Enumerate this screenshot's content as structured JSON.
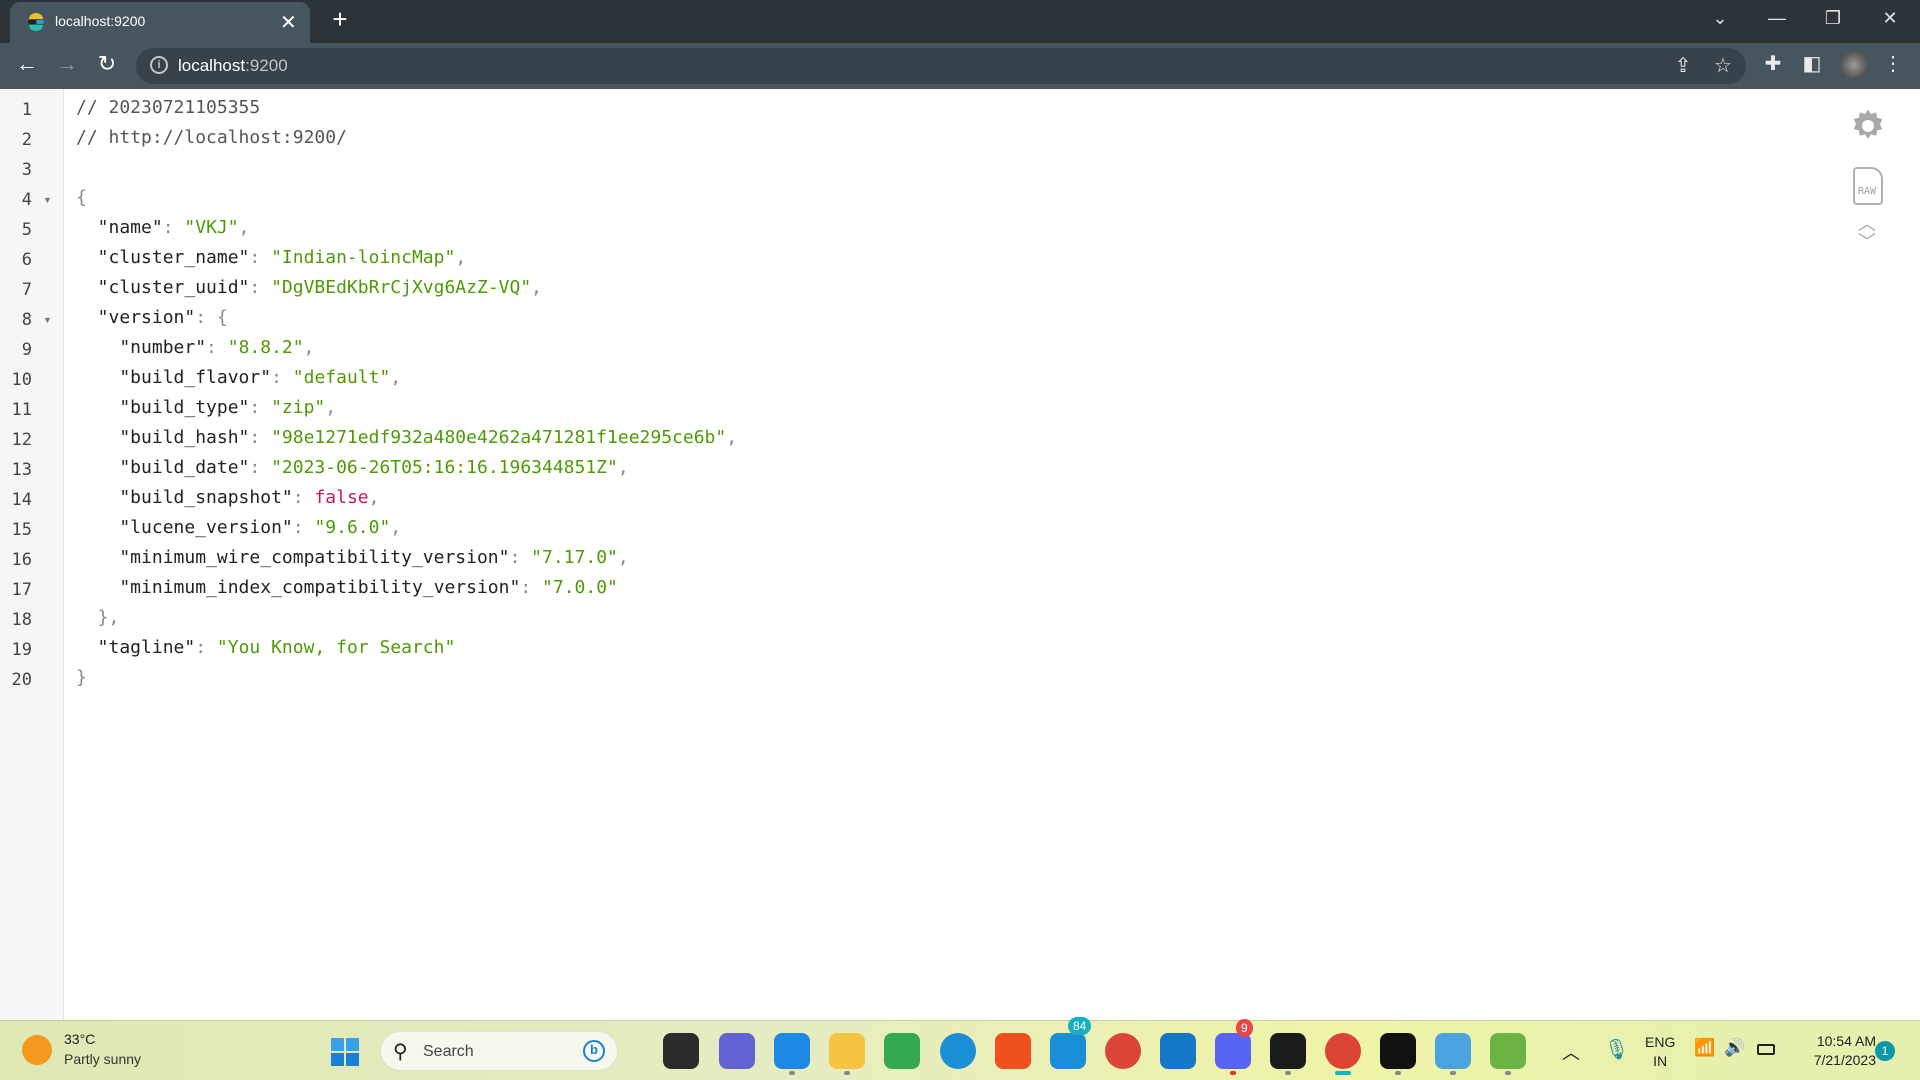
{
  "browser": {
    "tab_title": "localhost:9200",
    "url_host": "localhost",
    "url_port": ":9200",
    "new_tab": "+",
    "close": "✕"
  },
  "viewer": {
    "lines": [
      [
        [
          "c",
          "// 20230721105355"
        ]
      ],
      [
        [
          "c",
          "// http://localhost:9200/"
        ]
      ],
      [],
      [
        [
          "p",
          "{"
        ]
      ],
      [
        [
          "k",
          "  \"name\""
        ],
        [
          "p",
          ": "
        ],
        [
          "s",
          "\"VKJ\""
        ],
        [
          "p",
          ","
        ]
      ],
      [
        [
          "k",
          "  \"cluster_name\""
        ],
        [
          "p",
          ": "
        ],
        [
          "s",
          "\"Indian-loincMap\""
        ],
        [
          "p",
          ","
        ]
      ],
      [
        [
          "k",
          "  \"cluster_uuid\""
        ],
        [
          "p",
          ": "
        ],
        [
          "s",
          "\"DgVBEdKbRrCjXvg6AzZ-VQ\""
        ],
        [
          "p",
          ","
        ]
      ],
      [
        [
          "k",
          "  \"version\""
        ],
        [
          "p",
          ": {"
        ]
      ],
      [
        [
          "k",
          "    \"number\""
        ],
        [
          "p",
          ": "
        ],
        [
          "s",
          "\"8.8.2\""
        ],
        [
          "p",
          ","
        ]
      ],
      [
        [
          "k",
          "    \"build_flavor\""
        ],
        [
          "p",
          ": "
        ],
        [
          "s",
          "\"default\""
        ],
        [
          "p",
          ","
        ]
      ],
      [
        [
          "k",
          "    \"build_type\""
        ],
        [
          "p",
          ": "
        ],
        [
          "s",
          "\"zip\""
        ],
        [
          "p",
          ","
        ]
      ],
      [
        [
          "k",
          "    \"build_hash\""
        ],
        [
          "p",
          ": "
        ],
        [
          "s",
          "\"98e1271edf932a480e4262a471281f1ee295ce6b\""
        ],
        [
          "p",
          ","
        ]
      ],
      [
        [
          "k",
          "    \"build_date\""
        ],
        [
          "p",
          ": "
        ],
        [
          "s",
          "\"2023-06-26T05:16:16.196344851Z\""
        ],
        [
          "p",
          ","
        ]
      ],
      [
        [
          "k",
          "    \"build_snapshot\""
        ],
        [
          "p",
          ": "
        ],
        [
          "b",
          "false"
        ],
        [
          "p",
          ","
        ]
      ],
      [
        [
          "k",
          "    \"lucene_version\""
        ],
        [
          "p",
          ": "
        ],
        [
          "s",
          "\"9.6.0\""
        ],
        [
          "p",
          ","
        ]
      ],
      [
        [
          "k",
          "    \"minimum_wire_compatibility_version\""
        ],
        [
          "p",
          ": "
        ],
        [
          "s",
          "\"7.17.0\""
        ],
        [
          "p",
          ","
        ]
      ],
      [
        [
          "k",
          "    \"minimum_index_compatibility_version\""
        ],
        [
          "p",
          ": "
        ],
        [
          "s",
          "\"7.0.0\""
        ]
      ],
      [
        [
          "p",
          "  },"
        ]
      ],
      [
        [
          "k",
          "  \"tagline\""
        ],
        [
          "p",
          ": "
        ],
        [
          "s",
          "\"You Know, for Search\""
        ]
      ],
      [
        [
          "p",
          "}"
        ]
      ]
    ],
    "foldable_lines": [
      4,
      8
    ],
    "raw_label": "RAW"
  },
  "taskbar": {
    "weather_temp": "33°C",
    "weather_desc": "Partly sunny",
    "search_placeholder": "Search",
    "mail_badge": "84",
    "discord_badge": "9",
    "lang": "ENG",
    "region": "IN",
    "time": "10:54 AM",
    "date": "7/21/2023",
    "notification_count": "1",
    "apps": [
      {
        "name": "task-view",
        "color": "#2b2b2b"
      },
      {
        "name": "teams",
        "color": "#6264d4"
      },
      {
        "name": "vscode",
        "color": "#1e88e5"
      },
      {
        "name": "file-explorer",
        "color": "#f6c342"
      },
      {
        "name": "google-meet",
        "color": "#34a853"
      },
      {
        "name": "edge",
        "color": "#1b8fd6"
      },
      {
        "name": "brave",
        "color": "#f0501e"
      },
      {
        "name": "mail",
        "color": "#1a8fd8"
      },
      {
        "name": "chrome",
        "color": "#db4437"
      },
      {
        "name": "store",
        "color": "#1577c7"
      },
      {
        "name": "discord",
        "color": "#5865f2"
      },
      {
        "name": "webex",
        "color": "#1b1b1b"
      },
      {
        "name": "chrome-profile",
        "color": "#db4437"
      },
      {
        "name": "terminal",
        "color": "#111"
      },
      {
        "name": "notepad",
        "color": "#4aa3df"
      },
      {
        "name": "spring-tool",
        "color": "#6ab344"
      }
    ]
  }
}
